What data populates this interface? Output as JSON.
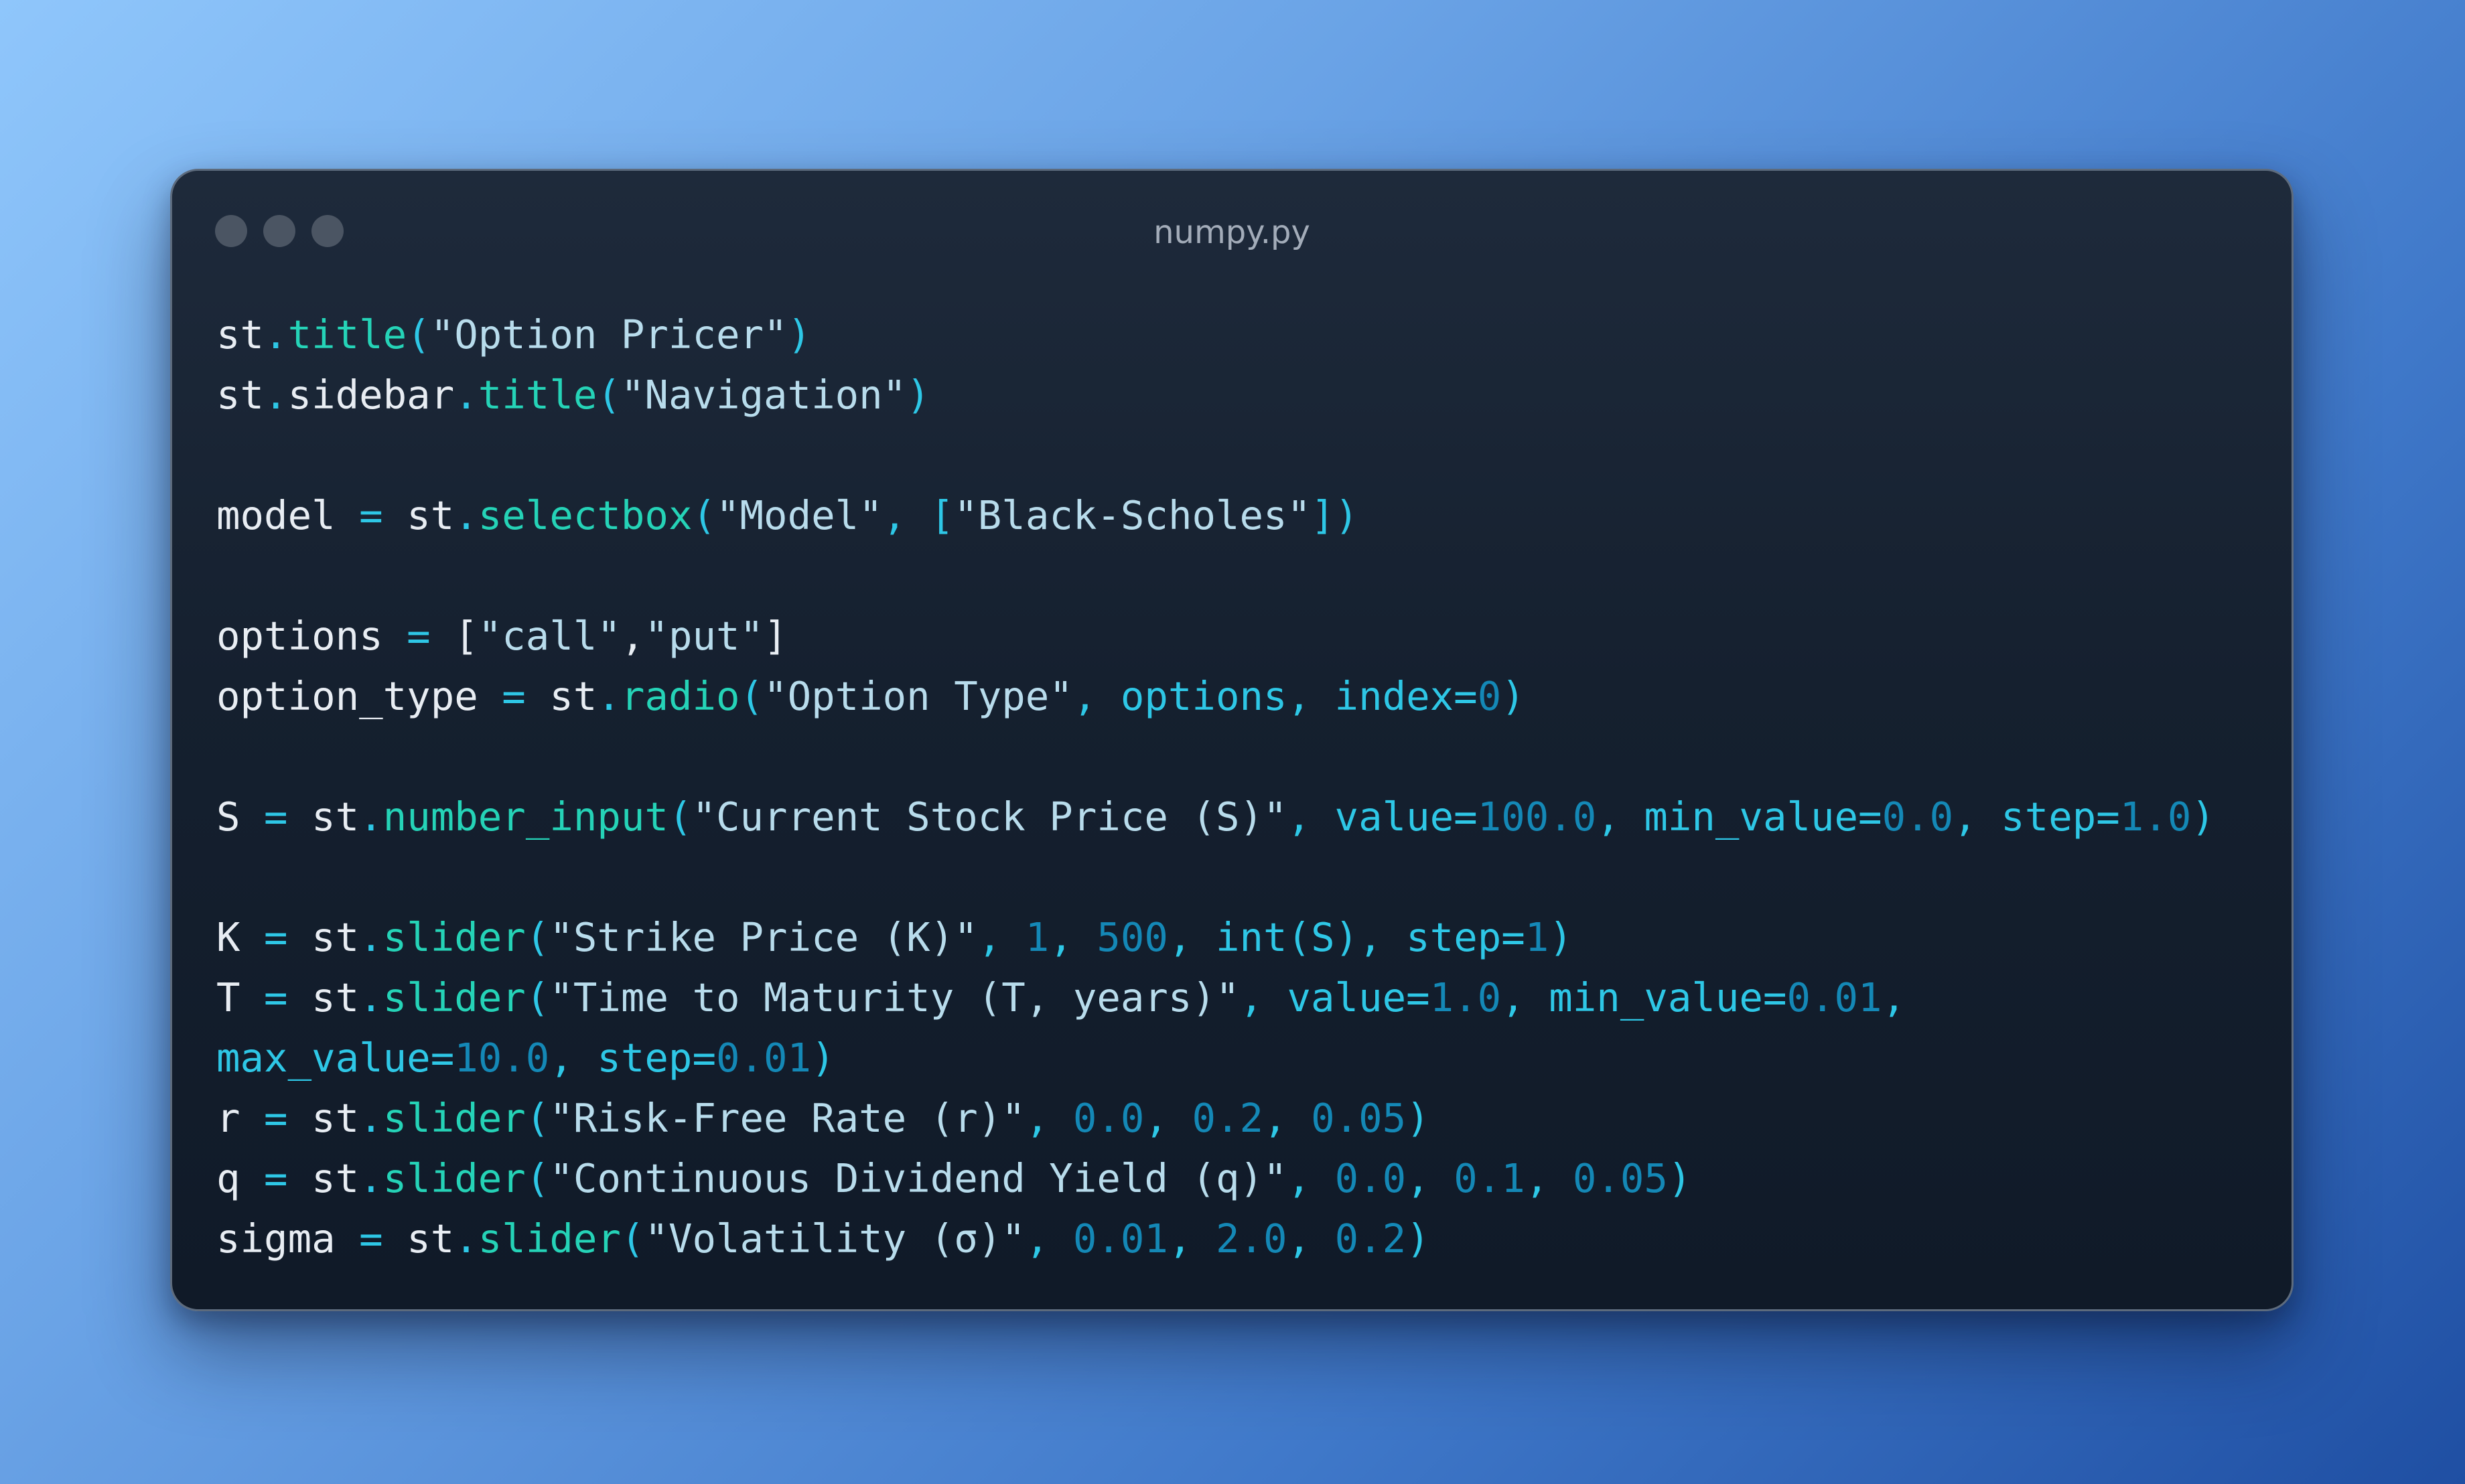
{
  "window": {
    "title": "numpy.py",
    "controls": [
      "close-dot",
      "minimize-dot",
      "maximize-dot"
    ]
  },
  "code_lines": [
    [
      {
        "t": "st",
        "k": "plain"
      },
      {
        "t": ".",
        "k": "op"
      },
      {
        "t": "title",
        "k": "fn"
      },
      {
        "t": "(",
        "k": "op"
      },
      {
        "t": "\"Option Pricer\"",
        "k": "str"
      },
      {
        "t": ")",
        "k": "op"
      }
    ],
    [
      {
        "t": "st",
        "k": "plain"
      },
      {
        "t": ".",
        "k": "op"
      },
      {
        "t": "sidebar",
        "k": "plain"
      },
      {
        "t": ".",
        "k": "op"
      },
      {
        "t": "title",
        "k": "fn"
      },
      {
        "t": "(",
        "k": "op"
      },
      {
        "t": "\"Navigation\"",
        "k": "str"
      },
      {
        "t": ")",
        "k": "op"
      }
    ],
    [],
    [
      {
        "t": "model ",
        "k": "plain"
      },
      {
        "t": "=",
        "k": "op"
      },
      {
        "t": " st",
        "k": "plain"
      },
      {
        "t": ".",
        "k": "op"
      },
      {
        "t": "selectbox",
        "k": "fn"
      },
      {
        "t": "(",
        "k": "op"
      },
      {
        "t": "\"Model\"",
        "k": "str"
      },
      {
        "t": ", [",
        "k": "op"
      },
      {
        "t": "\"Black-Scholes\"",
        "k": "str"
      },
      {
        "t": "])",
        "k": "op"
      }
    ],
    [],
    [
      {
        "t": "options ",
        "k": "plain"
      },
      {
        "t": "=",
        "k": "op"
      },
      {
        "t": " [",
        "k": "plain"
      },
      {
        "t": "\"call\"",
        "k": "str"
      },
      {
        "t": ",",
        "k": "plain"
      },
      {
        "t": "\"put\"",
        "k": "str"
      },
      {
        "t": "]",
        "k": "plain"
      }
    ],
    [
      {
        "t": "option_type ",
        "k": "plain"
      },
      {
        "t": "=",
        "k": "op"
      },
      {
        "t": " st",
        "k": "plain"
      },
      {
        "t": ".",
        "k": "op"
      },
      {
        "t": "radio",
        "k": "fn"
      },
      {
        "t": "(",
        "k": "op"
      },
      {
        "t": "\"Option Type\"",
        "k": "str"
      },
      {
        "t": ", options, index=",
        "k": "op"
      },
      {
        "t": "0",
        "k": "num"
      },
      {
        "t": ")",
        "k": "op"
      }
    ],
    [],
    [
      {
        "t": "S ",
        "k": "plain"
      },
      {
        "t": "=",
        "k": "op"
      },
      {
        "t": " st",
        "k": "plain"
      },
      {
        "t": ".",
        "k": "op"
      },
      {
        "t": "number_input",
        "k": "fn"
      },
      {
        "t": "(",
        "k": "op"
      },
      {
        "t": "\"Current Stock Price (S)\"",
        "k": "str"
      },
      {
        "t": ", value=",
        "k": "op"
      },
      {
        "t": "100.0",
        "k": "num"
      },
      {
        "t": ", min_value=",
        "k": "op"
      },
      {
        "t": "0.0",
        "k": "num"
      },
      {
        "t": ", step=",
        "k": "op"
      },
      {
        "t": "1.0",
        "k": "num"
      },
      {
        "t": ")",
        "k": "op"
      }
    ],
    [],
    [
      {
        "t": "K ",
        "k": "plain"
      },
      {
        "t": "=",
        "k": "op"
      },
      {
        "t": " st",
        "k": "plain"
      },
      {
        "t": ".",
        "k": "op"
      },
      {
        "t": "slider",
        "k": "fn"
      },
      {
        "t": "(",
        "k": "op"
      },
      {
        "t": "\"Strike Price (K)\"",
        "k": "str"
      },
      {
        "t": ", ",
        "k": "op"
      },
      {
        "t": "1",
        "k": "num"
      },
      {
        "t": ", ",
        "k": "op"
      },
      {
        "t": "500",
        "k": "num"
      },
      {
        "t": ", int(S), step=",
        "k": "op"
      },
      {
        "t": "1",
        "k": "num"
      },
      {
        "t": ")",
        "k": "op"
      }
    ],
    [
      {
        "t": "T ",
        "k": "plain"
      },
      {
        "t": "=",
        "k": "op"
      },
      {
        "t": " st",
        "k": "plain"
      },
      {
        "t": ".",
        "k": "op"
      },
      {
        "t": "slider",
        "k": "fn"
      },
      {
        "t": "(",
        "k": "op"
      },
      {
        "t": "\"Time to Maturity (T, years)\"",
        "k": "str"
      },
      {
        "t": ", value=",
        "k": "op"
      },
      {
        "t": "1.0",
        "k": "num"
      },
      {
        "t": ", min_value=",
        "k": "op"
      },
      {
        "t": "0.01",
        "k": "num"
      },
      {
        "t": ",",
        "k": "op"
      }
    ],
    [
      {
        "t": "max_value=",
        "k": "op"
      },
      {
        "t": "10.0",
        "k": "num"
      },
      {
        "t": ", step=",
        "k": "op"
      },
      {
        "t": "0.01",
        "k": "num"
      },
      {
        "t": ")",
        "k": "op"
      }
    ],
    [
      {
        "t": "r ",
        "k": "plain"
      },
      {
        "t": "=",
        "k": "op"
      },
      {
        "t": " st",
        "k": "plain"
      },
      {
        "t": ".",
        "k": "op"
      },
      {
        "t": "slider",
        "k": "fn"
      },
      {
        "t": "(",
        "k": "op"
      },
      {
        "t": "\"Risk-Free Rate (r)\"",
        "k": "str"
      },
      {
        "t": ", ",
        "k": "op"
      },
      {
        "t": "0.0",
        "k": "num"
      },
      {
        "t": ", ",
        "k": "op"
      },
      {
        "t": "0.2",
        "k": "num"
      },
      {
        "t": ", ",
        "k": "op"
      },
      {
        "t": "0.05",
        "k": "num"
      },
      {
        "t": ")",
        "k": "op"
      }
    ],
    [
      {
        "t": "q ",
        "k": "plain"
      },
      {
        "t": "=",
        "k": "op"
      },
      {
        "t": " st",
        "k": "plain"
      },
      {
        "t": ".",
        "k": "op"
      },
      {
        "t": "slider",
        "k": "fn"
      },
      {
        "t": "(",
        "k": "op"
      },
      {
        "t": "\"Continuous Dividend Yield (q)\"",
        "k": "str"
      },
      {
        "t": ", ",
        "k": "op"
      },
      {
        "t": "0.0",
        "k": "num"
      },
      {
        "t": ", ",
        "k": "op"
      },
      {
        "t": "0.1",
        "k": "num"
      },
      {
        "t": ", ",
        "k": "op"
      },
      {
        "t": "0.05",
        "k": "num"
      },
      {
        "t": ")",
        "k": "op"
      }
    ],
    [
      {
        "t": "sigma ",
        "k": "plain"
      },
      {
        "t": "=",
        "k": "op"
      },
      {
        "t": " st",
        "k": "plain"
      },
      {
        "t": ".",
        "k": "op"
      },
      {
        "t": "slider",
        "k": "fn"
      },
      {
        "t": "(",
        "k": "op"
      },
      {
        "t": "\"Volatility (σ)\"",
        "k": "str"
      },
      {
        "t": ", ",
        "k": "op"
      },
      {
        "t": "0.01",
        "k": "num"
      },
      {
        "t": ", ",
        "k": "op"
      },
      {
        "t": "2.0",
        "k": "num"
      },
      {
        "t": ", ",
        "k": "op"
      },
      {
        "t": "0.2",
        "k": "num"
      },
      {
        "t": ")",
        "k": "op"
      }
    ]
  ],
  "colors": {
    "plain": "#e8edf3",
    "function": "#25d3b7",
    "operator": "#2ec7e6",
    "string": "#b8dcec",
    "number": "#1488b6",
    "window_bg": "#16212f",
    "title_text": "#a3acb9"
  }
}
